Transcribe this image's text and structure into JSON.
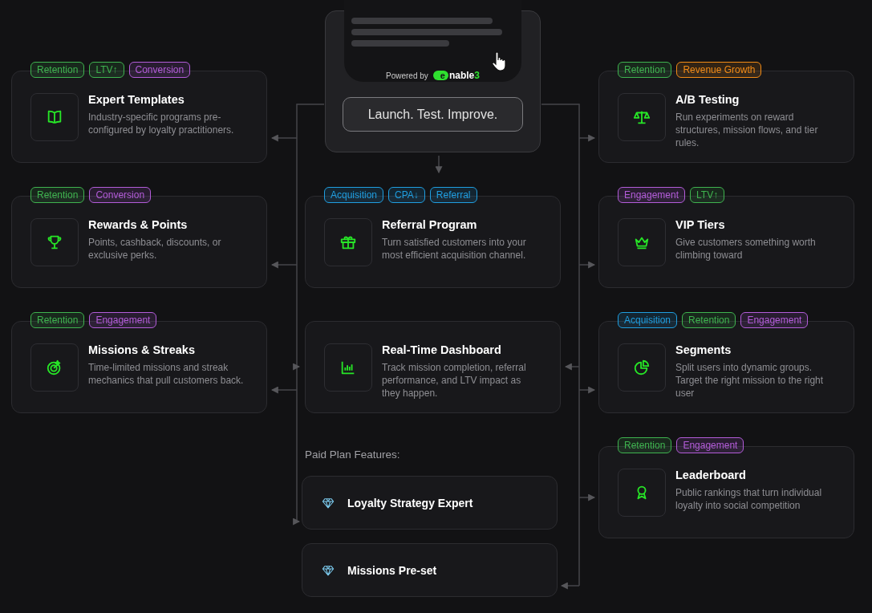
{
  "hero": {
    "powered_by": "Powered by",
    "logo": {
      "mark": "e",
      "name": "nable",
      "suffix": "3"
    },
    "button": "Launch. Test. Improve."
  },
  "left_column": {
    "cards": [
      {
        "title": "Expert Templates",
        "description": "Industry-specific programs pre-configured by loyalty practitioners.",
        "tags": [
          {
            "label": "Retention",
            "color": "#3fb34f"
          },
          {
            "label": "LTV↑",
            "color": "#3fb34f"
          },
          {
            "label": "Conversion",
            "color": "#b35cd9"
          }
        ]
      },
      {
        "title": "Rewards & Points",
        "description": "Points, cashback, discounts, or exclusive perks.",
        "tags": [
          {
            "label": "Retention",
            "color": "#3fb34f"
          },
          {
            "label": "Conversion",
            "color": "#b35cd9"
          }
        ]
      },
      {
        "title": "Missions & Streaks",
        "description": "Time-limited missions and streak mechanics that pull customers back.",
        "tags": [
          {
            "label": "Retention",
            "color": "#3fb34f"
          },
          {
            "label": "Engagement",
            "color": "#b35cd9"
          }
        ]
      }
    ]
  },
  "center_column": {
    "cards": [
      {
        "title": "Referral Program",
        "description": "Turn satisfied customers into your most efficient acquisition channel.",
        "tags": [
          {
            "label": "Acquisition",
            "color": "#1f9ee0"
          },
          {
            "label": "CPA↓",
            "color": "#1f9ee0"
          },
          {
            "label": "Referral",
            "color": "#1f9ee0"
          }
        ]
      },
      {
        "title": "Real-Time Dashboard",
        "description": "Track mission completion, referral performance, and LTV impact as they happen."
      }
    ],
    "paid_plan": {
      "heading": "Paid Plan Features:",
      "features": [
        "Loyalty Strategy Expert",
        "Missions Pre-set"
      ]
    }
  },
  "right_column": {
    "cards": [
      {
        "title": "A/B Testing",
        "description": "Run experiments on reward structures, mission flows, and tier rules.",
        "tags": [
          {
            "label": "Retention",
            "color": "#3fb34f"
          },
          {
            "label": "Revenue Growth",
            "color": "#f28b16"
          }
        ]
      },
      {
        "title": "VIP Tiers",
        "description": "Give customers something worth climbing toward",
        "tags": [
          {
            "label": "Engagement",
            "color": "#b35cd9"
          },
          {
            "label": "LTV↑",
            "color": "#3fb34f"
          }
        ]
      },
      {
        "title": "Segments",
        "description": "Split users into dynamic groups. Target the right mission to the right user",
        "tags": [
          {
            "label": "Acquisition",
            "color": "#1f9ee0"
          },
          {
            "label": "Retention",
            "color": "#3fb34f"
          },
          {
            "label": "Engagement",
            "color": "#b35cd9"
          }
        ]
      },
      {
        "title": "Leaderboard",
        "description": "Public rankings that turn individual loyalty into social competition",
        "tags": [
          {
            "label": "Retention",
            "color": "#3fb34f"
          },
          {
            "label": "Engagement",
            "color": "#b35cd9"
          }
        ]
      }
    ]
  }
}
